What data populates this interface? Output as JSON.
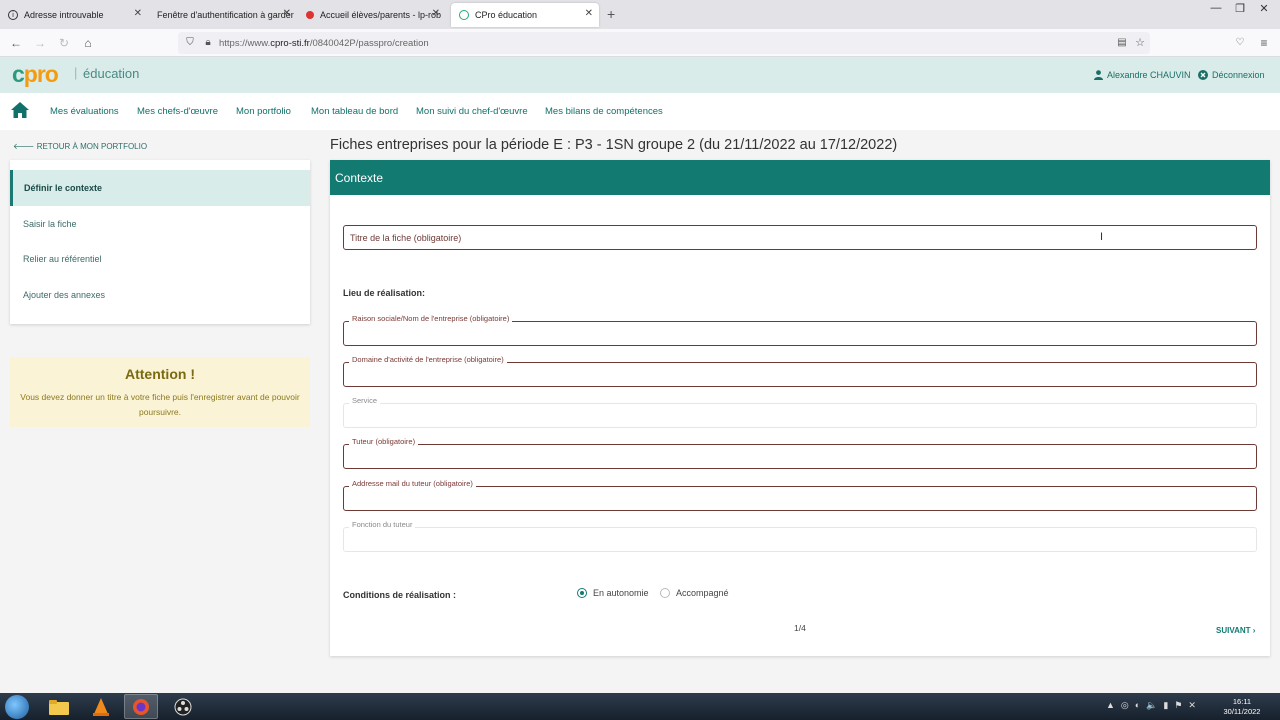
{
  "browser": {
    "tabs": [
      {
        "label": "Adresse introuvable",
        "icon": "info-icon",
        "active": false
      },
      {
        "label": "Fenêtre d'authentification à garder",
        "icon": "blank-page-icon",
        "active": false
      },
      {
        "label": "Accueil élèves/parents - lp-rob",
        "icon": "site-logo-icon",
        "active": false
      },
      {
        "label": "CPro éducation",
        "icon": "globe-icon",
        "active": true
      }
    ],
    "url_prefix": "https://www.",
    "url_domain": "cpro-sti.fr",
    "url_path": "/0840042P/passpro/creation"
  },
  "header": {
    "logo_text": "pro",
    "logo_letter": "c",
    "logo_separator": "|",
    "logo_subtitle": "éducation",
    "user_name": "Alexandre CHAUVIN",
    "logout_label": "Déconnexion"
  },
  "menu": {
    "items": [
      "Mes évaluations",
      "Mes chefs-d'œuvre",
      "Mon portfolio",
      "Mon tableau de bord",
      "Mon suivi du chef-d'œuvre",
      "Mes bilans de compétences"
    ]
  },
  "sidebar": {
    "back_label": "RETOUR À MON PORTFOLIO",
    "steps": [
      "Définir le contexte",
      "Saisir la fiche",
      "Relier au référentiel",
      "Ajouter des annexes"
    ],
    "attention_title": "Attention !",
    "attention_text": "Vous devez donner un titre à votre fiche puis l'enregistrer avant de pouvoir poursuivre."
  },
  "form": {
    "page_heading": "Fiches entreprises pour la période E : P3 - 1SN groupe 2 (du 21/11/2022 au 17/12/2022)",
    "card_title": "Contexte",
    "title_placeholder": "Titre de la fiche (obligatoire)",
    "location_label": "Lieu de réalisation:",
    "fields": [
      {
        "label": "Raison sociale/Nom de l'entreprise (obligatoire)",
        "value": ""
      },
      {
        "label": "Domaine d'activité de l'entreprise (obligatoire)",
        "value": ""
      },
      {
        "label": "Service",
        "value": ""
      },
      {
        "label": "Tuteur (obligatoire)",
        "value": ""
      },
      {
        "label": "Addresse mail du tuteur (obligatoire)",
        "value": ""
      },
      {
        "label": "Fonction du tuteur",
        "value": ""
      }
    ],
    "conditions_label": "Conditions de réalisation :",
    "conditions_options": [
      "En autonomie",
      "Accompagné"
    ],
    "conditions_selected": "En autonomie",
    "pager": "1/4",
    "next_label": "SUIVANT"
  },
  "taskbar": {
    "time": "16:11",
    "date": "30/11/2022"
  },
  "colors": {
    "primary": "#137a72",
    "header_bg": "#d9ecea",
    "logo_orange": "#f39c12",
    "required_border": "#6e3a36",
    "attention_bg": "#fbf3d6"
  }
}
